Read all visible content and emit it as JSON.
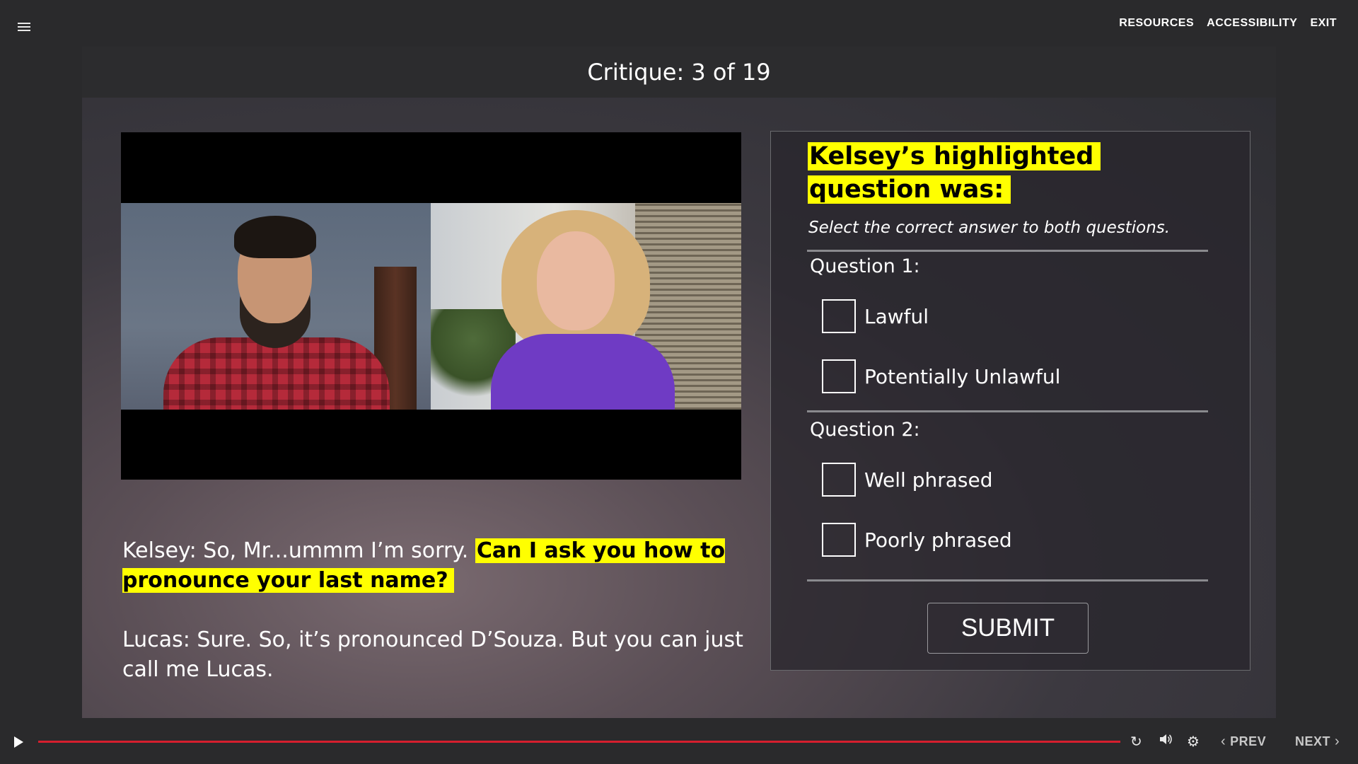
{
  "topnav": {
    "resources": "RESOURCES",
    "accessibility": "ACCESSIBILITY",
    "exit": "EXIT"
  },
  "slide": {
    "title": "Critique: 3 of 19"
  },
  "transcript": {
    "line1_prefix": "Kelsey: So, Mr...ummm I’m sorry. ",
    "line1_highlight": "Can I ask you how to pronounce your last name?",
    "line2": "Lucas: Sure. So, it’s pronounced D’Souza. But you can just call me Lucas."
  },
  "quiz": {
    "title": "Kelsey’s highlighted question was:",
    "instruction": "Select the correct answer to both questions.",
    "q1": {
      "label": "Question 1:",
      "options": [
        "Lawful",
        "Potentially Unlawful"
      ]
    },
    "q2": {
      "label": "Question 2:",
      "options": [
        "Well phrased",
        "Poorly phrased"
      ]
    },
    "submit": "SUBMIT"
  },
  "controls": {
    "prev": "PREV",
    "next": "NEXT",
    "icons": [
      "play-icon",
      "replay-icon",
      "volume-icon",
      "gear-icon",
      "chevron-left-icon",
      "chevron-right-icon"
    ],
    "progress_color": "#d61f2e"
  },
  "colors": {
    "highlight": "#ffff00",
    "background": "#2a2a2c"
  }
}
